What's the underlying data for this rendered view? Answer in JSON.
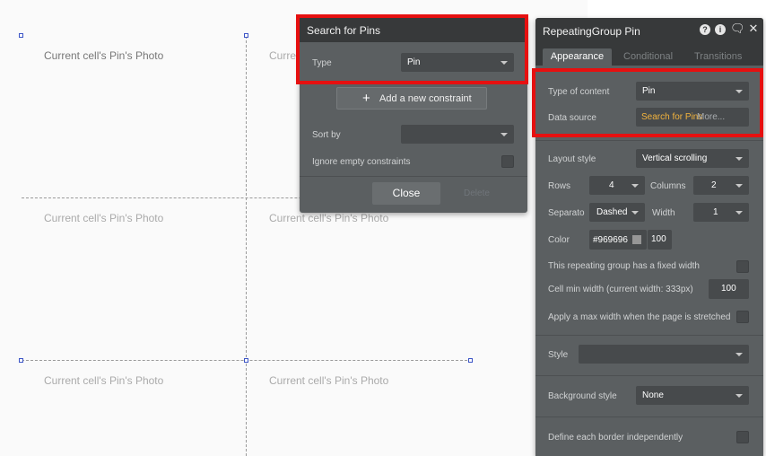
{
  "canvas": {
    "cells": [
      "Current cell's Pin's Photo",
      "Current cell's Pin's Photo",
      "Current cell's Pin's Photo",
      "Current cell's Pin's Photo",
      "Current cell's Pin's Photo",
      "Current cell's Pin's Photo"
    ],
    "peek_text": "Curre"
  },
  "search_popup": {
    "title": "Search for Pins",
    "type_label": "Type",
    "type_value": "Pin",
    "add_constraint_label": "Add a new constraint",
    "sort_by_label": "Sort by",
    "sort_by_value": "",
    "ignore_empty_label": "Ignore empty constraints",
    "close_label": "Close",
    "delete_label": "Delete"
  },
  "property_editor": {
    "title": "RepeatingGroup Pin",
    "header_icons": [
      "help-icon",
      "info-icon",
      "comment-icon",
      "close-icon"
    ],
    "tabs": [
      "Appearance",
      "Conditional",
      "Transitions"
    ],
    "type_of_content_label": "Type of content",
    "type_of_content_value": "Pin",
    "data_source_label": "Data source",
    "data_source_value": "Search for Pins",
    "data_source_more": "More...",
    "layout_style_label": "Layout style",
    "layout_style_value": "Vertical scrolling",
    "rows_label": "Rows",
    "rows_value": "4",
    "columns_label": "Columns",
    "columns_value": "2",
    "separator_label": "Separato",
    "separator_value": "Dashed",
    "width_label": "Width",
    "width_value": "1",
    "color_label": "Color",
    "color_value": "#969696",
    "color_opacity": "100",
    "fixed_width_label": "This repeating group has a fixed width",
    "cell_min_width_label": "Cell min width (current width: 333px)",
    "cell_min_width_value": "100",
    "max_width_label": "Apply a max width when the page is stretched",
    "style_label": "Style",
    "style_value": "",
    "background_style_label": "Background style",
    "background_style_value": "None",
    "border_label": "Define each border independently"
  },
  "colors": {
    "highlight": "#e61010",
    "panel": "#5b5f61",
    "header": "#37393a",
    "data_source": "#f2b33d"
  }
}
